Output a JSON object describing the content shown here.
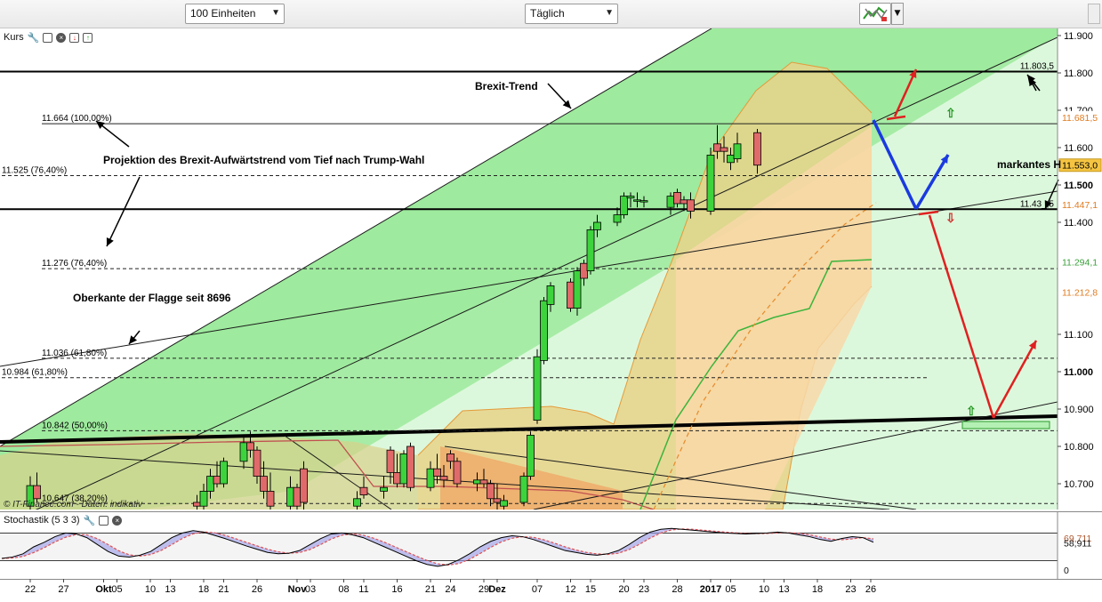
{
  "toolbar": {
    "unit_select": "100 Einheiten",
    "period_select": "Täglich"
  },
  "main_pane": {
    "label": "Kurs",
    "copyright": "© IT-Finance.com - Daten: indikativ"
  },
  "stoch_pane": {
    "label": "Stochastik (5 3 3)",
    "right_labels": [
      {
        "text": "69,711",
        "value": 69.711,
        "color": "#b05a32"
      },
      {
        "text": "58,911",
        "value": 58.911,
        "color": "#111111"
      },
      {
        "text": "0",
        "value": 0,
        "color": "#111111"
      }
    ]
  },
  "annotations": {
    "brexit_trend": "Brexit-Trend",
    "projection": "Projektion des  Brexit-Aufwärtstrend vom Tief nach Trump-Wahl",
    "flag": "Oberkante der Flagge seit 8696",
    "markantes": "markantes H"
  },
  "price_tags": [
    {
      "text": "11.681,5",
      "value": 11681.5,
      "color": "#e07b20",
      "bg": "#ffffff"
    },
    {
      "text": "11.553,0",
      "value": 11553.0,
      "color": "#000000",
      "bg": "#f5c542"
    },
    {
      "text": "11.447,1",
      "value": 11447.1,
      "color": "#e07b20",
      "bg": "#ffffff"
    },
    {
      "text": "11.294,1",
      "value": 11294.1,
      "color": "#3aa13a",
      "bg": "#ffffff"
    },
    {
      "text": "11.212,8",
      "value": 11212.8,
      "color": "#e07b20",
      "bg": "#ffffff"
    }
  ],
  "chart_data": {
    "type": "candlestick",
    "y_axis": {
      "min": 10630,
      "max": 11910,
      "ticks": [
        {
          "value": 11900,
          "label": "11.900",
          "bold": false
        },
        {
          "value": 11800,
          "label": "11.800",
          "bold": false
        },
        {
          "value": 11700,
          "label": "11.700",
          "bold": false
        },
        {
          "value": 11600,
          "label": "11.600",
          "bold": false
        },
        {
          "value": 11500,
          "label": "11.500",
          "bold": true
        },
        {
          "value": 11400,
          "label": "11.400",
          "bold": false
        },
        {
          "value": 11100,
          "label": "11.100",
          "bold": false
        },
        {
          "value": 11000,
          "label": "11.000",
          "bold": true
        },
        {
          "value": 10900,
          "label": "10.900",
          "bold": false
        },
        {
          "value": 10800,
          "label": "10.800",
          "bold": false
        },
        {
          "value": 10700,
          "label": "10.700",
          "bold": false
        }
      ]
    },
    "x_axis": {
      "start": "2016-09-20",
      "ticks": [
        {
          "date": "2016-09-22",
          "label": "22",
          "bold": false
        },
        {
          "date": "2016-09-27",
          "label": "27",
          "bold": false
        },
        {
          "date": "2016-10-03",
          "label": "Okt",
          "bold": true
        },
        {
          "date": "2016-10-05",
          "label": "05",
          "bold": false
        },
        {
          "date": "2016-10-10",
          "label": "10",
          "bold": false
        },
        {
          "date": "2016-10-13",
          "label": "13",
          "bold": false
        },
        {
          "date": "2016-10-18",
          "label": "18",
          "bold": false
        },
        {
          "date": "2016-10-21",
          "label": "21",
          "bold": false
        },
        {
          "date": "2016-10-26",
          "label": "26",
          "bold": false
        },
        {
          "date": "2016-11-01",
          "label": "Nov",
          "bold": true
        },
        {
          "date": "2016-11-03",
          "label": "03",
          "bold": false
        },
        {
          "date": "2016-11-08",
          "label": "08",
          "bold": false
        },
        {
          "date": "2016-11-11",
          "label": "11",
          "bold": false
        },
        {
          "date": "2016-11-16",
          "label": "16",
          "bold": false
        },
        {
          "date": "2016-11-21",
          "label": "21",
          "bold": false
        },
        {
          "date": "2016-11-24",
          "label": "24",
          "bold": false
        },
        {
          "date": "2016-11-29",
          "label": "29",
          "bold": false
        },
        {
          "date": "2016-12-01",
          "label": "Dez",
          "bold": true
        },
        {
          "date": "2016-12-07",
          "label": "07",
          "bold": false
        },
        {
          "date": "2016-12-12",
          "label": "12",
          "bold": false
        },
        {
          "date": "2016-12-15",
          "label": "15",
          "bold": false
        },
        {
          "date": "2016-12-20",
          "label": "20",
          "bold": false
        },
        {
          "date": "2016-12-23",
          "label": "23",
          "bold": false
        },
        {
          "date": "2016-12-28",
          "label": "28",
          "bold": false
        },
        {
          "date": "2017-01-02",
          "label": "2017",
          "bold": true
        },
        {
          "date": "2017-01-05",
          "label": "05",
          "bold": false
        },
        {
          "date": "2017-01-10",
          "label": "10",
          "bold": false
        },
        {
          "date": "2017-01-13",
          "label": "13",
          "bold": false
        },
        {
          "date": "2017-01-18",
          "label": "18",
          "bold": false
        },
        {
          "date": "2017-01-23",
          "label": "23",
          "bold": false
        },
        {
          "date": "2017-01-26",
          "label": "26",
          "bold": false
        }
      ]
    },
    "candles": [
      {
        "date": "2016-09-22",
        "o": 10640,
        "h": 10720,
        "l": 10600,
        "c": 10695
      },
      {
        "date": "2016-09-23",
        "o": 10695,
        "h": 10730,
        "l": 10650,
        "c": 10660
      },
      {
        "date": "2016-10-17",
        "o": 10650,
        "h": 10670,
        "l": 10610,
        "c": 10640
      },
      {
        "date": "2016-10-18",
        "o": 10640,
        "h": 10700,
        "l": 10630,
        "c": 10680
      },
      {
        "date": "2016-10-19",
        "o": 10680,
        "h": 10740,
        "l": 10660,
        "c": 10720
      },
      {
        "date": "2016-10-20",
        "o": 10720,
        "h": 10760,
        "l": 10690,
        "c": 10700
      },
      {
        "date": "2016-10-21",
        "o": 10700,
        "h": 10770,
        "l": 10690,
        "c": 10760
      },
      {
        "date": "2016-10-24",
        "o": 10760,
        "h": 10830,
        "l": 10740,
        "c": 10810
      },
      {
        "date": "2016-10-25",
        "o": 10810,
        "h": 10840,
        "l": 10770,
        "c": 10790
      },
      {
        "date": "2016-10-26",
        "o": 10790,
        "h": 10800,
        "l": 10700,
        "c": 10720
      },
      {
        "date": "2016-10-27",
        "o": 10720,
        "h": 10760,
        "l": 10660,
        "c": 10680
      },
      {
        "date": "2016-10-28",
        "o": 10680,
        "h": 10730,
        "l": 10630,
        "c": 10640
      },
      {
        "date": "2016-10-31",
        "o": 10640,
        "h": 10720,
        "l": 10620,
        "c": 10690
      },
      {
        "date": "2016-11-01",
        "o": 10690,
        "h": 10700,
        "l": 10620,
        "c": 10640
      },
      {
        "date": "2016-11-02",
        "o": 10740,
        "h": 10760,
        "l": 10620,
        "c": 10650
      },
      {
        "date": "2016-11-10",
        "o": 10640,
        "h": 10680,
        "l": 10600,
        "c": 10660
      },
      {
        "date": "2016-11-11",
        "o": 10690,
        "h": 10720,
        "l": 10660,
        "c": 10670
      },
      {
        "date": "2016-11-14",
        "o": 10680,
        "h": 10720,
        "l": 10660,
        "c": 10690
      },
      {
        "date": "2016-11-15",
        "o": 10790,
        "h": 10800,
        "l": 10700,
        "c": 10730
      },
      {
        "date": "2016-11-16",
        "o": 10730,
        "h": 10780,
        "l": 10690,
        "c": 10700
      },
      {
        "date": "2016-11-17",
        "o": 10700,
        "h": 10790,
        "l": 10690,
        "c": 10780
      },
      {
        "date": "2016-11-18",
        "o": 10800,
        "h": 10810,
        "l": 10680,
        "c": 10690
      },
      {
        "date": "2016-11-21",
        "o": 10690,
        "h": 10760,
        "l": 10680,
        "c": 10740
      },
      {
        "date": "2016-11-22",
        "o": 10740,
        "h": 10780,
        "l": 10700,
        "c": 10720
      },
      {
        "date": "2016-11-23",
        "o": 10720,
        "h": 10750,
        "l": 10690,
        "c": 10710
      },
      {
        "date": "2016-11-24",
        "o": 10780,
        "h": 10790,
        "l": 10740,
        "c": 10760
      },
      {
        "date": "2016-11-25",
        "o": 10760,
        "h": 10770,
        "l": 10690,
        "c": 10700
      },
      {
        "date": "2016-11-28",
        "o": 10700,
        "h": 10730,
        "l": 10680,
        "c": 10710
      },
      {
        "date": "2016-11-29",
        "o": 10710,
        "h": 10740,
        "l": 10690,
        "c": 10700
      },
      {
        "date": "2016-11-30",
        "o": 10700,
        "h": 10710,
        "l": 10640,
        "c": 10660
      },
      {
        "date": "2016-12-01",
        "o": 10660,
        "h": 10700,
        "l": 10630,
        "c": 10650
      },
      {
        "date": "2016-12-02",
        "o": 10640,
        "h": 10670,
        "l": 10620,
        "c": 10655
      },
      {
        "date": "2016-12-05",
        "o": 10650,
        "h": 10730,
        "l": 10640,
        "c": 10720
      },
      {
        "date": "2016-12-06",
        "o": 10720,
        "h": 10840,
        "l": 10710,
        "c": 10830
      },
      {
        "date": "2016-12-07",
        "o": 10870,
        "h": 11060,
        "l": 10860,
        "c": 11040
      },
      {
        "date": "2016-12-08",
        "o": 11030,
        "h": 11200,
        "l": 11020,
        "c": 11190
      },
      {
        "date": "2016-12-09",
        "o": 11180,
        "h": 11240,
        "l": 11160,
        "c": 11230
      },
      {
        "date": "2016-12-12",
        "o": 11240,
        "h": 11250,
        "l": 11160,
        "c": 11170
      },
      {
        "date": "2016-12-13",
        "o": 11170,
        "h": 11280,
        "l": 11150,
        "c": 11270
      },
      {
        "date": "2016-12-14",
        "o": 11290,
        "h": 11300,
        "l": 11230,
        "c": 11250
      },
      {
        "date": "2016-12-15",
        "o": 11270,
        "h": 11390,
        "l": 11260,
        "c": 11380
      },
      {
        "date": "2016-12-16",
        "o": 11380,
        "h": 11420,
        "l": 11360,
        "c": 11400
      },
      {
        "date": "2016-12-19",
        "o": 11400,
        "h": 11440,
        "l": 11390,
        "c": 11420
      },
      {
        "date": "2016-12-20",
        "o": 11420,
        "h": 11480,
        "l": 11410,
        "c": 11470
      },
      {
        "date": "2016-12-21",
        "o": 11465,
        "h": 11480,
        "l": 11440,
        "c": 11470
      },
      {
        "date": "2016-12-22",
        "o": 11460,
        "h": 11480,
        "l": 11440,
        "c": 11460
      },
      {
        "date": "2016-12-23",
        "o": 11455,
        "h": 11470,
        "l": 11440,
        "c": 11458
      },
      {
        "date": "2016-12-27",
        "o": 11440,
        "h": 11480,
        "l": 11420,
        "c": 11470
      },
      {
        "date": "2016-12-28",
        "o": 11480,
        "h": 11490,
        "l": 11440,
        "c": 11450
      },
      {
        "date": "2016-12-29",
        "o": 11460,
        "h": 11470,
        "l": 11430,
        "c": 11450
      },
      {
        "date": "2016-12-30",
        "o": 11460,
        "h": 11480,
        "l": 11410,
        "c": 11430
      },
      {
        "date": "2017-01-02",
        "o": 11430,
        "h": 11600,
        "l": 11420,
        "c": 11580
      },
      {
        "date": "2017-01-03",
        "o": 11610,
        "h": 11660,
        "l": 11570,
        "c": 11590
      },
      {
        "date": "2017-01-04",
        "o": 11600,
        "h": 11630,
        "l": 11560,
        "c": 11590
      },
      {
        "date": "2017-01-05",
        "o": 11560,
        "h": 11600,
        "l": 11540,
        "c": 11580
      },
      {
        "date": "2017-01-06",
        "o": 11570,
        "h": 11640,
        "l": 11560,
        "c": 11610
      },
      {
        "date": "2017-01-09",
        "o": 11640,
        "h": 11650,
        "l": 11530,
        "c": 11553
      }
    ],
    "fib_levels": [
      {
        "label": "11.664 (100,00%)",
        "value": 11664,
        "solid": true
      },
      {
        "label": "11.525 (76,40%)",
        "value": 11525,
        "solid": false
      },
      {
        "label": "11.276 (76,40%)",
        "value": 11276,
        "solid": false
      },
      {
        "label": "11.036 (61,80%)",
        "value": 11036,
        "solid": false
      },
      {
        "label": "10.984 (61,80%)",
        "value": 10984,
        "solid": false
      },
      {
        "label": "10.842 (50,00%)",
        "value": 10842,
        "solid": false
      },
      {
        "label": "10.647 (38,20%)",
        "value": 10647,
        "solid": false
      }
    ],
    "horizontal_lines": [
      {
        "label": "11.803,5",
        "value": 11803.5
      },
      {
        "label": "11.43_,5",
        "value": 11435
      }
    ],
    "stochastic": {
      "range": [
        0,
        100
      ],
      "k_values": [
        25,
        28,
        35,
        50,
        60,
        72,
        80,
        78,
        70,
        55,
        40,
        30,
        28,
        32,
        40,
        55,
        70,
        80,
        85,
        82,
        75,
        68,
        60,
        52,
        45,
        38,
        35,
        36,
        42,
        55,
        68,
        78,
        80,
        76,
        70,
        60,
        50,
        40,
        30,
        20,
        12,
        8,
        12,
        22,
        35,
        50,
        62,
        70,
        74,
        72,
        66,
        58,
        50,
        42,
        38,
        34,
        32,
        35,
        42,
        55,
        70,
        82,
        88,
        90,
        88,
        86,
        84,
        82,
        80,
        79,
        78,
        79,
        80,
        82,
        80,
        76,
        72,
        66,
        62,
        68,
        72,
        70,
        60
      ]
    }
  }
}
